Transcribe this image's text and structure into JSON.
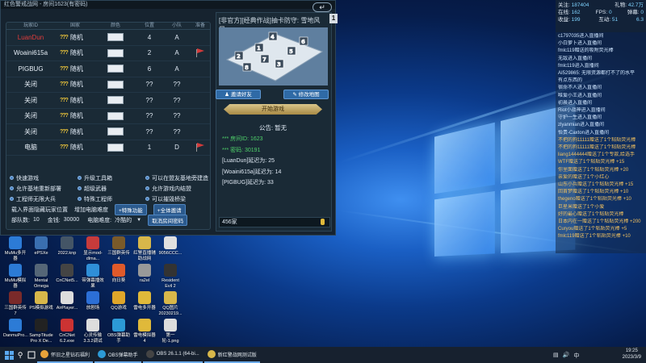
{
  "window": {
    "title": "红色警戒战网 - 房间1623(有密码)",
    "back_icon": "back-arrow-icon"
  },
  "players": {
    "headers": [
      "玩家ID",
      "国家",
      "颜色",
      "位置",
      "小队",
      "准备"
    ],
    "rows": [
      {
        "name": "LuanDun",
        "name_color": "#e23c3c",
        "country": "随机",
        "pos": "4",
        "team": "A",
        "ready": false
      },
      {
        "name": "Woaini615a",
        "name_color": "#e6eef6",
        "country": "随机",
        "pos": "2",
        "team": "A",
        "ready": true
      },
      {
        "name": "PIGBUG",
        "name_color": "#e6eef6",
        "country": "随机",
        "pos": "6",
        "team": "A",
        "ready": false
      },
      {
        "name": "关闭",
        "name_color": "#e6eef6",
        "country": "随机",
        "pos": "??",
        "team": "??",
        "ready": false
      },
      {
        "name": "关闭",
        "name_color": "#e6eef6",
        "country": "随机",
        "pos": "??",
        "team": "??",
        "ready": false
      },
      {
        "name": "关闭",
        "name_color": "#e6eef6",
        "country": "随机",
        "pos": "??",
        "team": "??",
        "ready": false
      },
      {
        "name": "关闭",
        "name_color": "#e6eef6",
        "country": "随机",
        "pos": "??",
        "team": "??",
        "ready": false
      },
      {
        "name": "电脑",
        "name_color": "#e6eef6",
        "country": "随机",
        "pos": "1",
        "team": "D",
        "ready": true
      }
    ],
    "race_glyph": "???"
  },
  "options": {
    "row1": [
      "快速游戏",
      "升级工具箱",
      "可以在盟友基地旁建造"
    ],
    "row2": [
      "允许基地重新部署",
      "超级武器",
      "允许游戏内结盟"
    ],
    "row3": [
      "工程师无限大兵",
      "特殊工程师",
      "可以摧毁桥梁"
    ],
    "row4_label": "载入界面隐藏玩家位置",
    "row4_mid": "增加电脑难度",
    "btn_special": "+特殊功能",
    "btn_all": "+全体邀请",
    "units_label": "部队数:",
    "units_value": "10",
    "money_label": "金钱:",
    "money_value": "30000",
    "ai_label": "电脑难度:",
    "ai_value": "冷酷的",
    "cancel_password": "取消房间密码"
  },
  "room": {
    "title": "[非官方][经典作战]抽卡防守: 雪地风暴",
    "number": "1",
    "invite": "邀请好友",
    "change_map": "修改地图",
    "start": "开始游戏",
    "notice": "公告: 暂无",
    "chat": [
      {
        "text": "*** 房间ID: 1623",
        "green": true
      },
      {
        "text": "*** 密码: 30191",
        "green": true
      },
      {
        "text": "[LuanDun]延迟为: 25",
        "green": false
      },
      {
        "text": "[Woaini615a]延迟为: 14",
        "green": false
      },
      {
        "text": "[PIGBUG]延迟为: 33",
        "green": false
      }
    ],
    "input": "456家"
  },
  "stats": {
    "a_label": "关注:",
    "a_val": "187404",
    "b_label": "礼物:",
    "b_val": "42.7万",
    "c_label": "在线:",
    "c_val": "162",
    "d_label": "弹幕:",
    "d_val": "0",
    "fps_label": "FPS:",
    "fps_val": "0",
    "e_label": "收益:",
    "e_val": "199",
    "f_label": "互动:",
    "f_val": "51",
    "g_val": "6.3"
  },
  "chatlog": [
    "c1797035进入直播间",
    "小白萝卜进入直播间",
    "fmlc119赠送的吸附荧光棒",
    "无敌进入直播间",
    "fmlc119进入直播间",
    "AI529865: 无限资源都打不了的水平",
    "有点东西的",
    "宿命不人进入直播间",
    "唯爱小王进入直播间",
    "初晨进入直播间",
    "Riot小战神进入直播间",
    "守护一生进入直播间",
    "zlyanmian进入直播间",
    "怡贵-Caxton进入直播间",
    "不把的狗11111赠送了1个粘贴荧光棒",
    "不把的狗11111赠送了1个粘贴荧光棒",
    "liang1444444赠送了1个专款,给选手",
    "WTF赠送了1个粘贴荧光棒 +15",
    "你里面赠送了1个粘贴荧光棒 +20",
    "亲爱的赠送了1个小红心",
    "山东小兵赠送了1个粘贴荧光棒 +15",
    "回首梦赠送了1个粘贴荧光棒 +10",
    "thegeno赠送了1个粘贴荧光棒 +10",
    "巨星米赠送了1个小爱",
    "好的最心赠送了1个粘贴荧光棒",
    "日本内在一赠送了1个粘贴荧光棒 +200",
    "Curyou赠送了1个粘贴荧光棒 +5",
    "fmlc119赠送了1个粘贴荧光棒 +10"
  ],
  "desktop_icons": [
    {
      "label": "MuMu多开器",
      "color": "#2c7bd6"
    },
    {
      "label": "ePSXe",
      "color": "#3a6fb0"
    },
    {
      "label": "2022.knp",
      "color": "#445566"
    },
    {
      "label": "显示mod-dlma...",
      "color": "#c73b3b"
    },
    {
      "label": "三国群英传4",
      "color": "#7a5a2a"
    },
    {
      "label": "红警直播辅助战网",
      "color": "#d8b74a"
    },
    {
      "label": "9056CCC...",
      "color": "#e0e0e0"
    },
    {
      "label": "MuMu模拟器",
      "color": "#2c7bd6"
    },
    {
      "label": "Mental Omega",
      "color": "#556677"
    },
    {
      "label": "CnCNet5...",
      "color": "#444"
    },
    {
      "label": "带弹幕播效果",
      "color": "#2f8fd8"
    },
    {
      "label": "向日葵",
      "color": "#e05a2a"
    },
    {
      "label": "ra2el",
      "color": "#999"
    },
    {
      "label": "Resident Evil 2",
      "color": "#333"
    },
    {
      "label": "三国群英传7",
      "color": "#7a2a2a"
    },
    {
      "label": "PS模拟游戏",
      "color": "#d8b74a"
    },
    {
      "label": "AirPlayer...",
      "color": "#dddddd"
    },
    {
      "label": "放剧场",
      "color": "#2c6fd6"
    },
    {
      "label": "QQ游戏",
      "color": "#e0a62a"
    },
    {
      "label": "雷电多开器",
      "color": "#e0b93a"
    },
    {
      "label": "QQ图片20230219...",
      "color": "#d8b74a"
    },
    {
      "label": "DanmuPro...",
      "color": "#2c7bd6"
    },
    {
      "label": "SampTitude Pro X De...",
      "color": "#222"
    },
    {
      "label": "CnCNet 6.2.exe",
      "color": "#c33"
    },
    {
      "label": "心灵传输3.3.2调试",
      "color": "#ddd"
    },
    {
      "label": "OBS弹幕助手",
      "color": "#2c9ad6"
    },
    {
      "label": "雷电模拟器4",
      "color": "#e0b93a"
    },
    {
      "label": "第一轮-1.png",
      "color": "#ddd"
    }
  ],
  "taskbar": {
    "items": [
      "怀旧之星钻石福利",
      "OBS弹幕助手",
      "OBS 26.1.1 (64-bi...",
      "新红警战网测试版"
    ],
    "time": "19:25",
    "date": "2023/3/9",
    "ime": "中"
  }
}
